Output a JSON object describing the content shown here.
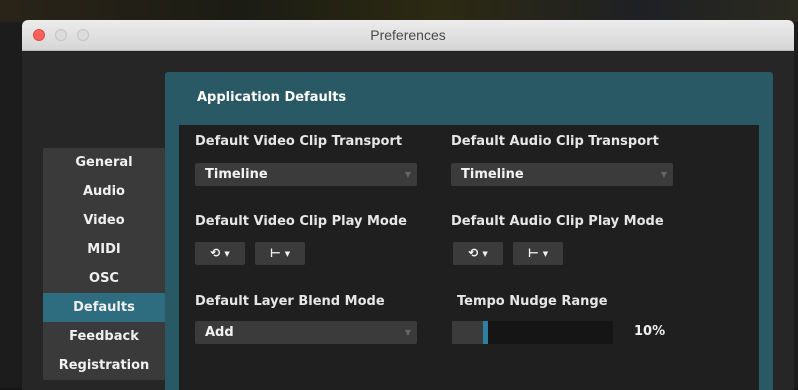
{
  "window": {
    "title": "Preferences"
  },
  "sidebar": {
    "items": [
      {
        "label": "General"
      },
      {
        "label": "Audio"
      },
      {
        "label": "Video"
      },
      {
        "label": "MIDI"
      },
      {
        "label": "OSC"
      },
      {
        "label": "Defaults",
        "active": true
      },
      {
        "label": "Feedback"
      },
      {
        "label": "Registration"
      }
    ]
  },
  "panel": {
    "title": "Application Defaults",
    "video_transport": {
      "label": "Default Video Clip Transport",
      "value": "Timeline"
    },
    "audio_transport": {
      "label": "Default Audio Clip Transport",
      "value": "Timeline"
    },
    "video_play_mode": {
      "label": "Default Video Clip Play Mode",
      "loop_icon": "loop-icon",
      "direction_icon": "play-forward-icon"
    },
    "audio_play_mode": {
      "label": "Default Audio Clip Play Mode",
      "loop_icon": "loop-icon",
      "direction_icon": "play-forward-icon"
    },
    "blend_mode": {
      "label": "Default Layer Blend Mode",
      "value": "Add"
    },
    "tempo_nudge": {
      "label": "Tempo Nudge Range",
      "value_text": "10%",
      "value": 0.2
    }
  },
  "colors": {
    "accent": "#2e6c80",
    "panel": "#2a5966",
    "slider_thumb": "#2f7fa0"
  }
}
